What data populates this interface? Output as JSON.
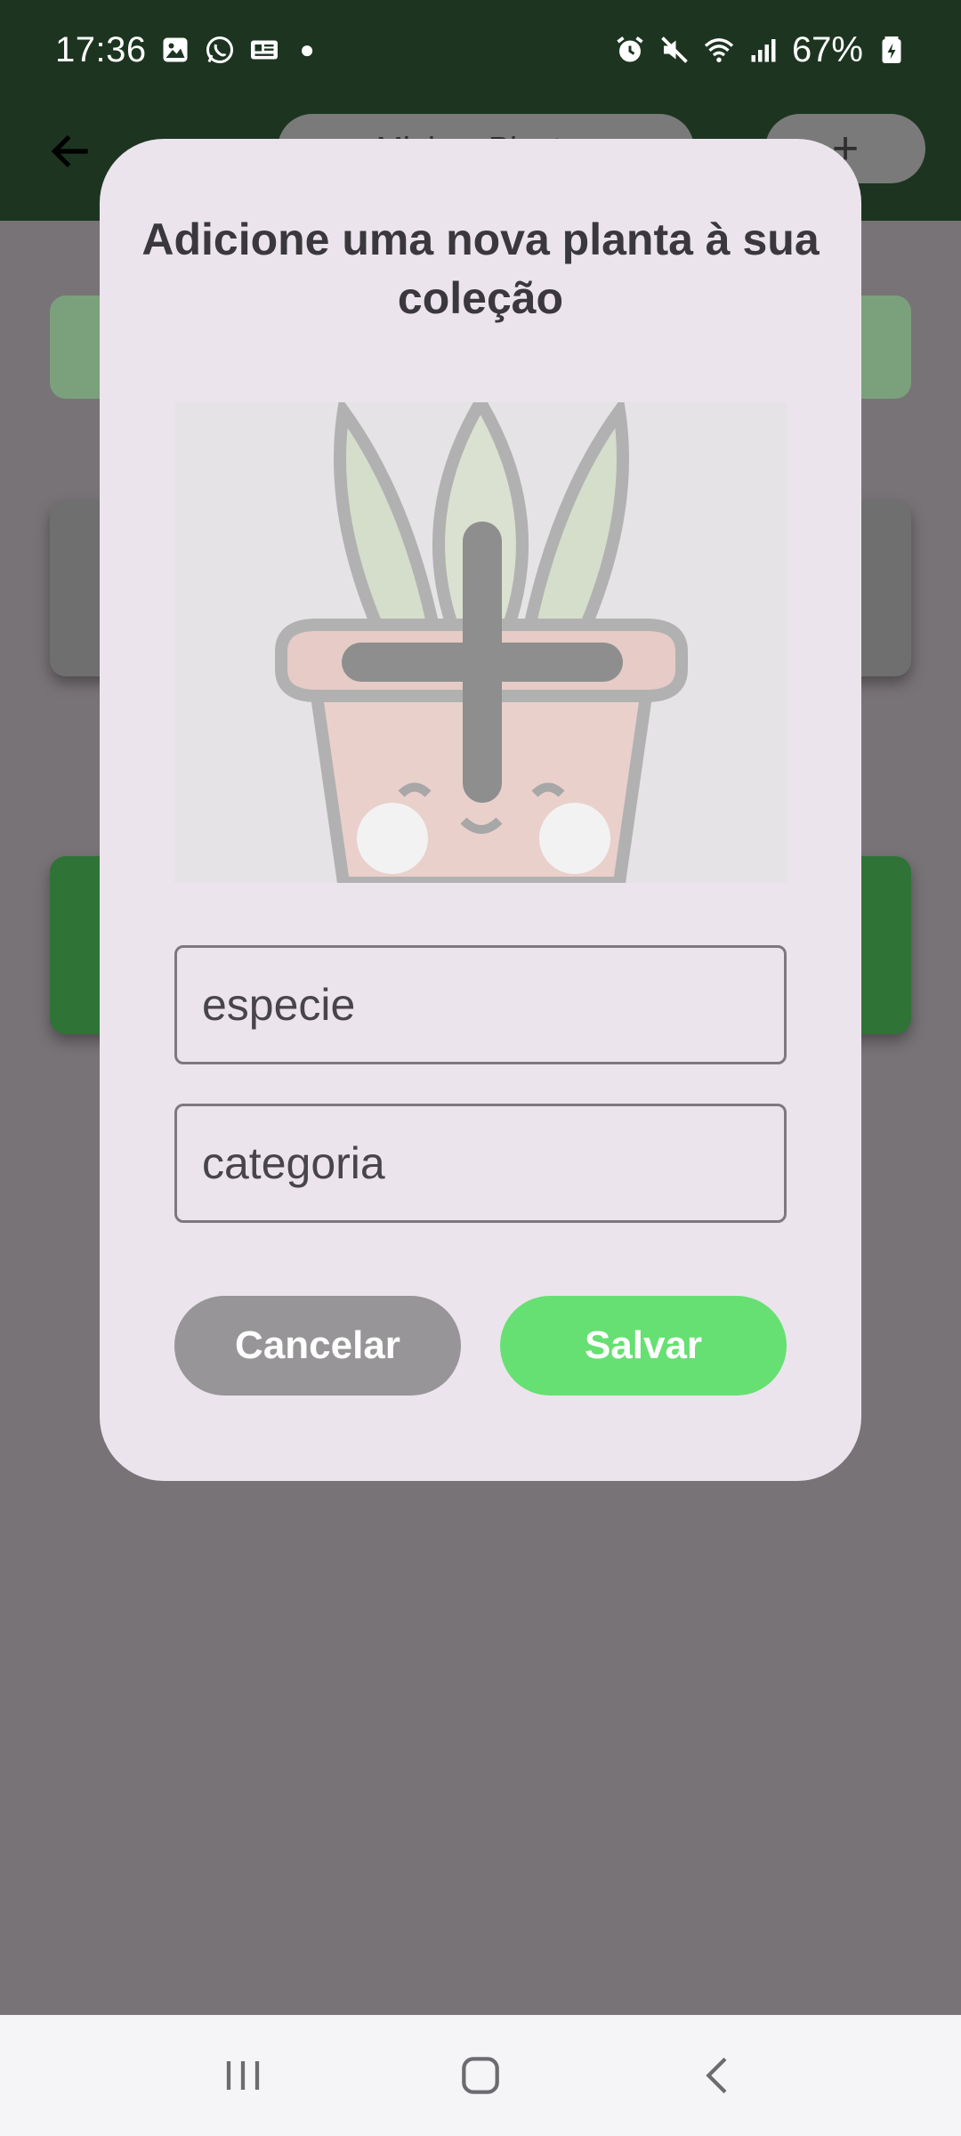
{
  "status_bar": {
    "time": "17:36",
    "left_icons": [
      "gallery-icon",
      "whatsapp-icon",
      "news-icon",
      "notification-dot"
    ],
    "right_icons": [
      "alarm-icon",
      "mute-icon",
      "wifi-icon",
      "signal-icon",
      "battery-icon"
    ],
    "battery": "67%"
  },
  "app_bar": {
    "title": "Minhas Plantas",
    "add_label": "+"
  },
  "dialog": {
    "title": "Adicione uma nova planta à sua coleção",
    "image_picker_icon": "add-icon",
    "fields": {
      "especie": {
        "placeholder": "especie",
        "value": ""
      },
      "categoria": {
        "placeholder": "categoria",
        "value": ""
      }
    },
    "buttons": {
      "cancel": "Cancelar",
      "save": "Salvar"
    }
  },
  "nav_bar": {
    "items": [
      "recents-icon",
      "home-icon",
      "back-icon"
    ]
  },
  "colors": {
    "app_bar": "#1d3520",
    "scrim": "#787377",
    "dialog_bg": "#ebe4ec",
    "cancel_button": "#979597",
    "save_button": "#66e072"
  }
}
